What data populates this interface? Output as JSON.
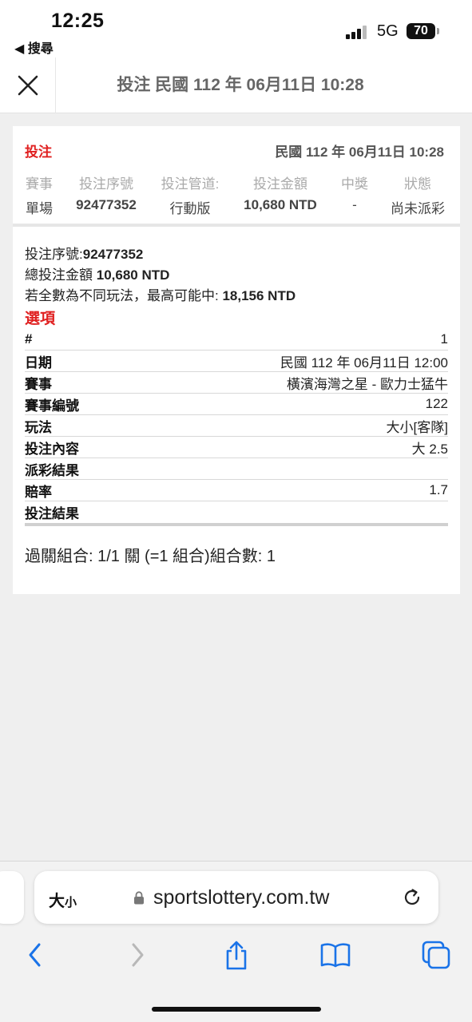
{
  "status_bar": {
    "time": "12:25",
    "back_app": "◀ 搜尋",
    "network": "5G",
    "battery": "70"
  },
  "header": {
    "close_icon": "close-icon",
    "title": "投注 民國 112 年 06月11日 10:28"
  },
  "summary": {
    "title": "投注",
    "date": "民國 112 年 06月11日 10:28",
    "headers": [
      "賽事",
      "投注序號",
      "投注管道:",
      "投注金額",
      "中獎",
      "狀態"
    ],
    "values": [
      "單場",
      "92477352",
      "行動版",
      "10,680 NTD",
      "-",
      "尚未派彩"
    ]
  },
  "detail": {
    "serial_label": "投注序號:",
    "serial_value": "92477352",
    "total_label": "總投注金額 ",
    "total_value": "10,680 NTD",
    "max_label": "若全數為不同玩法，最高可能中: ",
    "max_value": "18,156 NTD",
    "options_title": "選項",
    "rows": [
      {
        "key": "#",
        "value": "1"
      },
      {
        "key": "日期",
        "value": "民國 112 年 06月11日 12:00"
      },
      {
        "key": "賽事",
        "value": "橫濱海灣之星 - 歐力士猛牛"
      },
      {
        "key": "賽事編號",
        "value": "122"
      },
      {
        "key": "玩法",
        "value": "大小[客隊]"
      },
      {
        "key": "投注內容",
        "value": "大 2.5"
      },
      {
        "key": "派彩結果",
        "value": ""
      },
      {
        "key": "賠率",
        "value": "1.7"
      },
      {
        "key": "投注結果",
        "value": ""
      }
    ],
    "combo": "過關組合: 1/1 關 (=1 組合)組合數: 1"
  },
  "browser": {
    "text_size_big": "大",
    "text_size_small": "小",
    "url": "sportslottery.com.tw",
    "accent": "#1a73e8"
  },
  "colors": {
    "red": "#e02020",
    "icon_blue": "#1a73e8"
  }
}
